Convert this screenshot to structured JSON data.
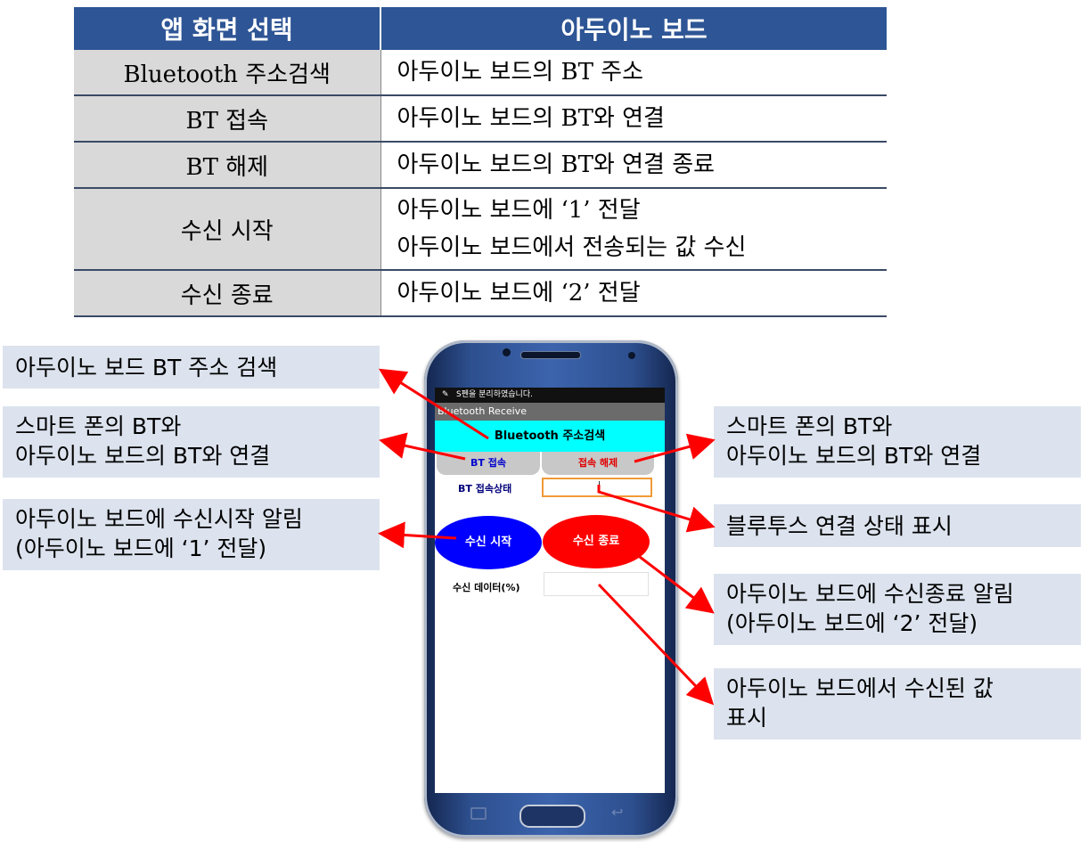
{
  "table": {
    "headers": [
      "앱 화면 선택",
      "아두이노 보드"
    ],
    "rows": [
      {
        "label": "Bluetooth 주소검색",
        "lines": [
          "아두이노 보드의 BT 주소"
        ]
      },
      {
        "label": "BT 접속",
        "lines": [
          "아두이노 보드의 BT와 연결"
        ]
      },
      {
        "label": "BT 해제",
        "lines": [
          "아두이노 보드의 BT와 연결 종료"
        ]
      },
      {
        "label": "수신 시작",
        "lines": [
          "아두이노 보드에 ‘1’ 전달",
          "아두이노 보드에서 전송되는 값 수신"
        ]
      },
      {
        "label": "수신 종료",
        "lines": [
          "아두이노 보드에 ‘2’ 전달"
        ]
      }
    ]
  },
  "callouts": {
    "scan": [
      "아두이노 보드 BT 주소 검색"
    ],
    "connect": [
      "스마트 폰의 BT와",
      "아두이노 보드의 BT와 연결"
    ],
    "start": [
      "아두이노 보드에 수신시작 알림",
      "(아두이노 보드에 ‘1’ 전달)"
    ],
    "disconnect": [
      "스마트 폰의 BT와",
      "아두이노 보드의 BT와 연결"
    ],
    "status": [
      "블루투스 연결 상태 표시"
    ],
    "stop": [
      "아두이노 보드에 수신종료 알림",
      "(아두이노 보드에 ‘2’ 전달)"
    ],
    "received": [
      "아두이노 보드에서 수신된 값",
      "표시"
    ]
  },
  "phone": {
    "status_bar_text": "S펜을 분리하였습니다.",
    "app_title": "Bluetooth Receive",
    "scan_button": "Bluetooth 주소검색",
    "connect_button": "BT 접속",
    "disconnect_button": "접속 해제",
    "connection_state_label": "BT 접속상태",
    "connection_state_value": "",
    "start_button": "수신 시작",
    "stop_button": "수신 종료",
    "data_label": "수신 데이터(%)",
    "data_value": ""
  },
  "colors": {
    "table_header": "#2e5595",
    "table_label_cell": "#d9d9d9",
    "callout_bg": "#dce3ee",
    "arrow": "#ff0000",
    "scan_button": "#00ffff",
    "start_button": "#0000ff",
    "stop_button": "#ff0000"
  }
}
